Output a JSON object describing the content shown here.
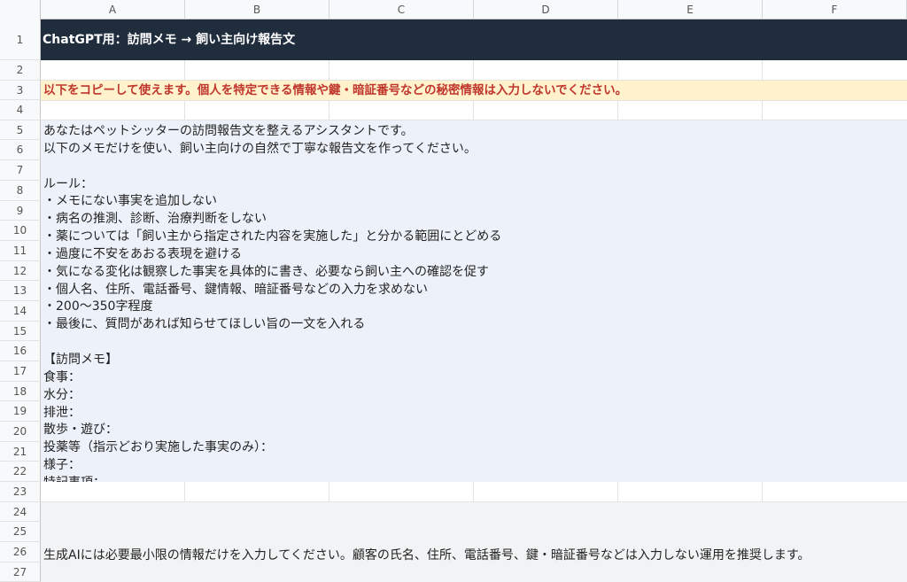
{
  "columns": [
    "A",
    "B",
    "C",
    "D",
    "E",
    "F"
  ],
  "rows": [
    "1",
    "2",
    "3",
    "4",
    "5",
    "6",
    "7",
    "8",
    "9",
    "10",
    "11",
    "12",
    "13",
    "14",
    "15",
    "16",
    "17",
    "18",
    "19",
    "20",
    "21",
    "22",
    "23",
    "24",
    "25",
    "26",
    "27"
  ],
  "title": "ChatGPT用：訪問メモ → 飼い主向け報告文",
  "warning": "以下をコピーして使えます。個人を特定できる情報や鍵・暗証番号などの秘密情報は入力しないでください。",
  "prompt_lines": [
    "あなたはペットシッターの訪問報告文を整えるアシスタントです。",
    "以下のメモだけを使い、飼い主向けの自然で丁寧な報告文を作ってください。",
    "",
    "ルール：",
    "・メモにない事実を追加しない",
    "・病名の推測、診断、治療判断をしない",
    "・薬については「飼い主から指定された内容を実施した」と分かる範囲にとどめる",
    "・過度に不安をあおる表現を避ける",
    "・気になる変化は観察した事実を具体的に書き、必要なら飼い主への確認を促す",
    "・個人名、住所、電話番号、鍵情報、暗証番号などの入力を求めない",
    "・200〜350字程度",
    "・最後に、質問があれば知らせてほしい旨の一文を入れる",
    "",
    "【訪問メモ】",
    "食事：",
    "水分：",
    "排泄：",
    "散歩・遊び：",
    "投薬等（指示どおり実施した事実のみ）：",
    "様子：",
    "特記事項："
  ],
  "footer_note": "生成AIには必要最小限の情報だけを入力してください。顧客の氏名、住所、電話番号、鍵・暗証番号などは入力しない運用を推奨します。"
}
